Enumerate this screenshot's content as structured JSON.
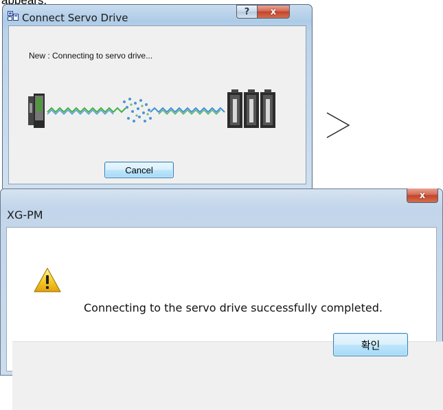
{
  "caption": "appears.",
  "dialog1": {
    "title": "Connect Servo Drive",
    "status": "New : Connecting to servo drive...",
    "cancel_label": "Cancel",
    "help_glyph": "?",
    "close_glyph": "x"
  },
  "arrow_icon": "chevron-right",
  "dialog2": {
    "title": "XG-PM",
    "close_glyph": "x",
    "message": "Connecting to the servo drive successfully completed.",
    "ok_label": "확인",
    "icon": "warning-triangle"
  },
  "colors": {
    "accent_button": "#3c7fb1",
    "close_red": "#c2442b",
    "wave_green": "#3fae4a",
    "wave_blue": "#3f8fd8"
  }
}
